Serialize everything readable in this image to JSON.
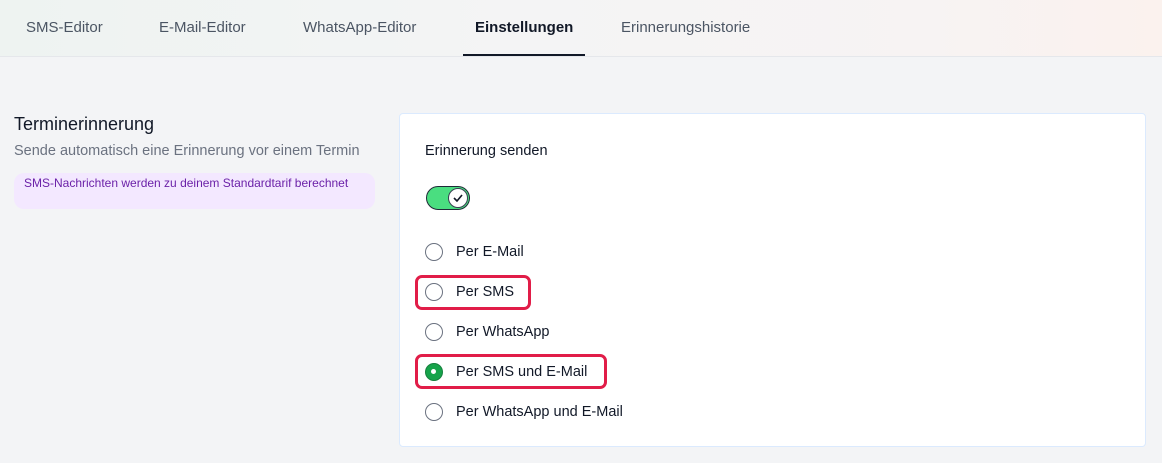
{
  "tabs": [
    {
      "label": "SMS-Editor",
      "active": false
    },
    {
      "label": "E-Mail-Editor",
      "active": false
    },
    {
      "label": "WhatsApp-Editor",
      "active": false
    },
    {
      "label": "Einstellungen",
      "active": true
    },
    {
      "label": "Erinnerungshistorie",
      "active": false
    }
  ],
  "section": {
    "title": "Terminerinnerung",
    "subtitle": "Sende automatisch eine Erinnerung vor einem Termin",
    "notice": "SMS-Nachrichten werden zu deinem Standardtarif berechnet"
  },
  "card": {
    "label": "Erinnerung senden",
    "toggle_on": true,
    "options": [
      {
        "label": "Per E-Mail",
        "checked": false,
        "highlighted": false
      },
      {
        "label": "Per SMS",
        "checked": false,
        "highlighted": true
      },
      {
        "label": "Per WhatsApp",
        "checked": false,
        "highlighted": false
      },
      {
        "label": "Per SMS und E-Mail",
        "checked": true,
        "highlighted": true
      },
      {
        "label": "Per WhatsApp und E-Mail",
        "checked": false,
        "highlighted": false
      }
    ]
  },
  "colors": {
    "toggle_on": "#4ade80",
    "radio_checked": "#16a34a",
    "highlight_border": "#e11d48",
    "notice_bg": "#f3e8ff",
    "notice_text": "#6b21a8"
  },
  "icons": {
    "toggle_knob": "check-icon"
  }
}
